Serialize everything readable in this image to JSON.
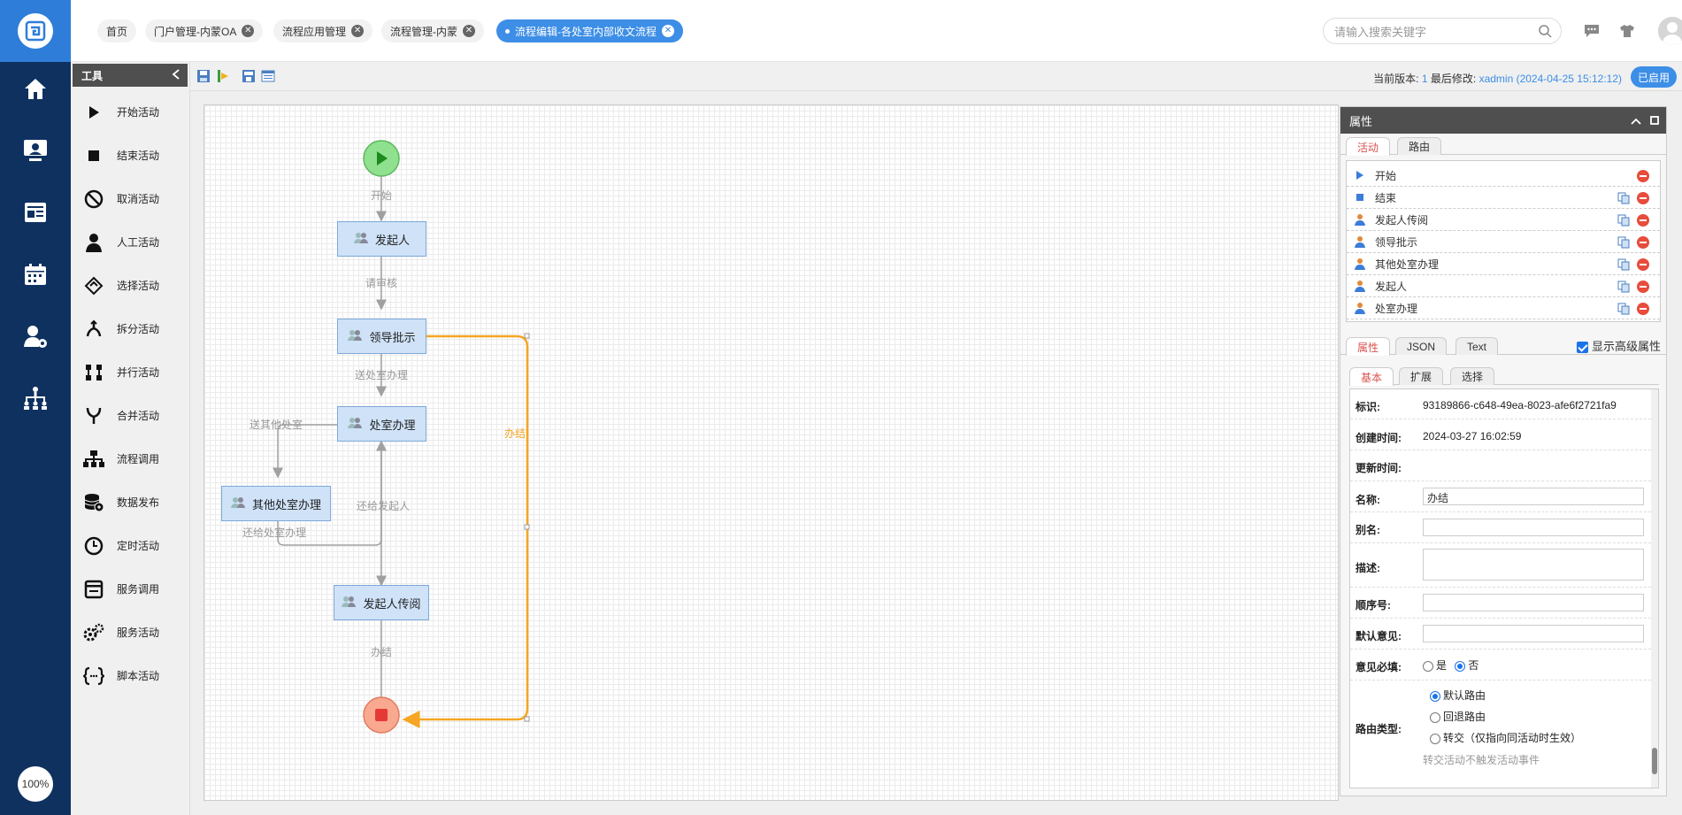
{
  "header": {
    "tabs": [
      {
        "label": "首页"
      },
      {
        "label": "门户管理-内蒙OA"
      },
      {
        "label": "流程应用管理"
      },
      {
        "label": "流程管理-内蒙"
      },
      {
        "label": "流程编辑-各处室内部收文流程"
      }
    ],
    "search_placeholder": "请输入搜索关键字",
    "username": "xadmin"
  },
  "leftnav": {
    "zoom": "100%"
  },
  "tools": {
    "title": "工具",
    "items": [
      {
        "label": "开始活动",
        "icon": "play-icon"
      },
      {
        "label": "结束活动",
        "icon": "stop-icon"
      },
      {
        "label": "取消活动",
        "icon": "cancel-icon"
      },
      {
        "label": "人工活动",
        "icon": "person-icon"
      },
      {
        "label": "选择活动",
        "icon": "choice-icon"
      },
      {
        "label": "拆分活动",
        "icon": "split-icon"
      },
      {
        "label": "并行活动",
        "icon": "parallel-icon"
      },
      {
        "label": "合并活动",
        "icon": "merge-icon"
      },
      {
        "label": "流程调用",
        "icon": "tree-icon"
      },
      {
        "label": "数据发布",
        "icon": "database-icon"
      },
      {
        "label": "定时活动",
        "icon": "clock-icon"
      },
      {
        "label": "服务调用",
        "icon": "window-icon"
      },
      {
        "label": "服务活动",
        "icon": "gears-icon"
      },
      {
        "label": "脚本活动",
        "icon": "script-icon"
      }
    ]
  },
  "toolbar": {
    "version_label": "当前版本:",
    "version_value": "1",
    "modified_label": "最后修改:",
    "modified_value": "xadmin (2024-04-25 15:12:12)",
    "status": "已启用"
  },
  "flow": {
    "nodes": {
      "initiator": "发起人",
      "leader": "领导批示",
      "office": "处室办理",
      "other_office": "其他处室办理",
      "initiator_read": "发起人传阅"
    },
    "routes": {
      "start": "开始",
      "review": "请审核",
      "to_office": "送处室办理",
      "to_other": "送其他处室",
      "back_to_initiator": "还给发起人",
      "back_to_office": "还给处室办理",
      "done": "办结",
      "done_orange": "办结"
    }
  },
  "props": {
    "title": "属性",
    "top_tabs": [
      "活动",
      "路由"
    ],
    "activities": [
      "开始",
      "结束",
      "发起人传阅",
      "领导批示",
      "其他处室办理",
      "发起人",
      "处室办理"
    ],
    "mid_tabs": [
      "属性",
      "JSON",
      "Text"
    ],
    "advanced_label": "显示高级属性",
    "sub_tabs": [
      "基本",
      "扩展",
      "选择"
    ],
    "fields": {
      "id_label": "标识:",
      "id_value": "93189866-c648-49ea-8023-afe6f2721fa9",
      "created_label": "创建时间:",
      "created_value": "2024-03-27 16:02:59",
      "updated_label": "更新时间:",
      "name_label": "名称:",
      "name_value": "办结",
      "alias_label": "别名:",
      "desc_label": "描述:",
      "order_label": "顺序号:",
      "default_opinion_label": "默认意见:",
      "opinion_required_label": "意见必填:",
      "yes": "是",
      "no": "否",
      "route_type_label": "路由类型:",
      "route_default": "默认路由",
      "route_back": "回退路由",
      "route_transfer": "转交（仅指向同活动时生效）",
      "route_note": "转交活动不触发活动事件"
    }
  },
  "colors": {
    "accent": "#3d8ee6",
    "nav": "#0f3160",
    "orange": "#f5a623"
  }
}
